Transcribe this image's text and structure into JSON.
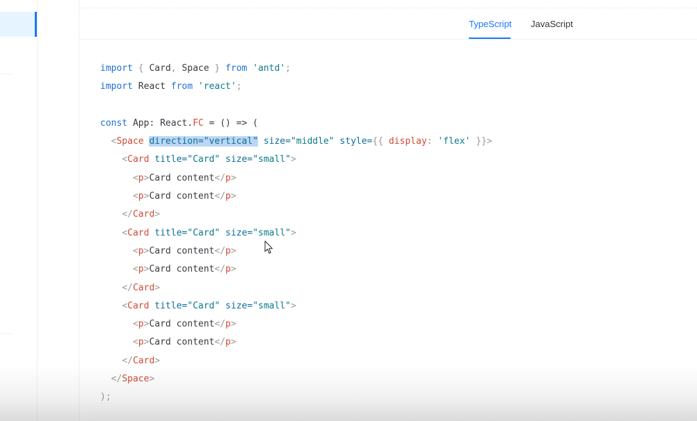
{
  "tabs": [
    {
      "label": "TypeScript",
      "active": true
    },
    {
      "label": "JavaScript",
      "active": false
    }
  ],
  "code": {
    "line1": {
      "kw1": "import",
      "p1": " { ",
      "n1": "Card",
      "p2": ", ",
      "n2": "Space",
      "p3": " } ",
      "kw2": "from",
      "p4": " ",
      "s1": "'antd'",
      "p5": ";"
    },
    "line2": {
      "kw1": "import",
      "n1": " React ",
      "kw2": "from",
      "p1": " ",
      "s1": "'react'",
      "p2": ";"
    },
    "line4": {
      "kw1": "const",
      "n1": " App: React.",
      "t1": "FC",
      "n2": " = () => ("
    },
    "line5": {
      "lt": "<",
      "tag": "Space",
      "sp": " ",
      "hl": "direction=\"vertical\"",
      "a2": " size=",
      "v2": "\"middle\"",
      "a3": " style=",
      "p3": "{{ ",
      "k3": "display",
      "p4": ": ",
      "v3": "'flex'",
      "p5": " }}",
      "gt": ">"
    },
    "card_open": {
      "lt": "<",
      "tag": "Card",
      "a1": " title=",
      "v1": "\"Card\"",
      "a2": " size=",
      "v2": "\"small\"",
      "gt": ">"
    },
    "p_line": {
      "lt": "<",
      "tag": "p",
      "gt": ">",
      "text": "Card content",
      "clt": "</",
      "ctag": "p",
      "cgt": ">"
    },
    "card_close": {
      "lt": "</",
      "tag": "Card",
      "gt": ">"
    },
    "space_close": {
      "lt": "</",
      "tag": "Space",
      "gt": ">"
    },
    "end": {
      "text": ");"
    }
  },
  "icons": {
    "cursor": "mouse-pointer-icon"
  },
  "colors": {
    "accent": "#1677ff"
  }
}
